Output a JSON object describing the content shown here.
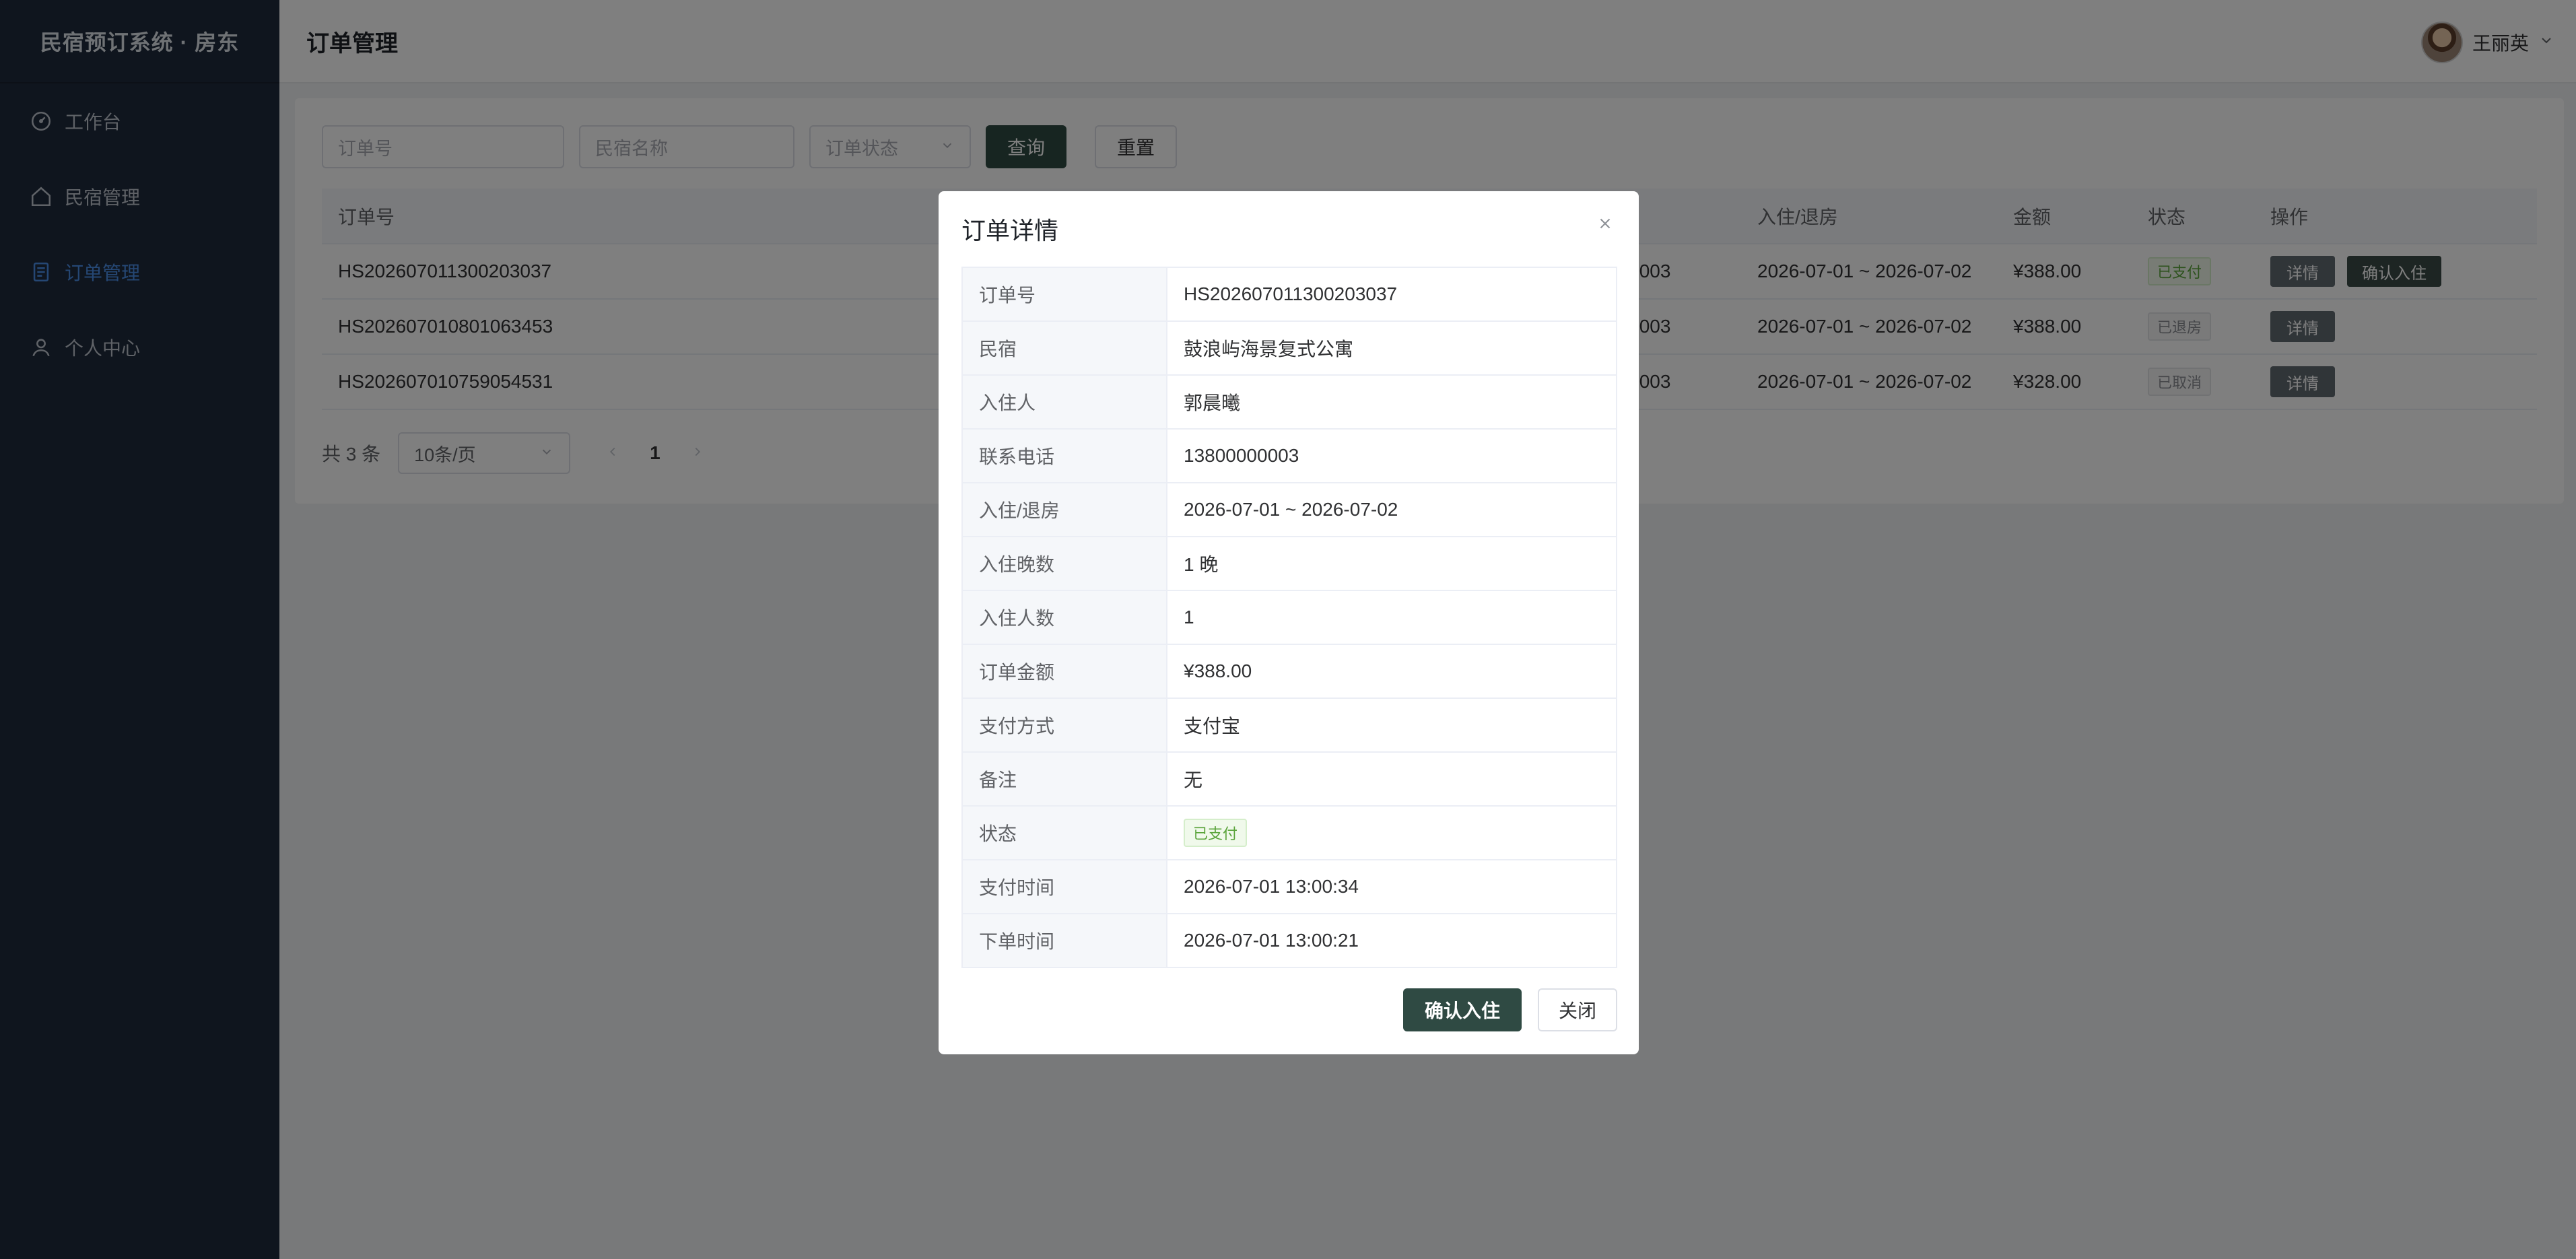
{
  "sidebar": {
    "brand": "民宿预订系统 · 房东",
    "items": [
      {
        "label": "工作台",
        "icon": "dashboard-icon"
      },
      {
        "label": "民宿管理",
        "icon": "home-icon"
      },
      {
        "label": "订单管理",
        "icon": "document-icon",
        "active": true
      },
      {
        "label": "个人中心",
        "icon": "user-icon"
      }
    ]
  },
  "header": {
    "title": "订单管理",
    "user_name": "王丽英"
  },
  "filters": {
    "order_no_placeholder": "订单号",
    "homestay_placeholder": "民宿名称",
    "status_placeholder": "订单状态",
    "query_label": "查询",
    "reset_label": "重置"
  },
  "table": {
    "columns": [
      "订单号",
      "入住/退房",
      "金额",
      "状态",
      "操作"
    ],
    "rows": [
      {
        "order_no": "HS202607011300203037",
        "phone_tail": "000003",
        "dates": "2026-07-01 ~ 2026-07-02",
        "amount": "¥388.00",
        "status": "已支付",
        "actions": [
          "详情",
          "确认入住"
        ]
      },
      {
        "order_no": "HS202607010801063453",
        "phone_tail": "000003",
        "dates": "2026-07-01 ~ 2026-07-02",
        "amount": "¥388.00",
        "status": "已退房",
        "actions": [
          "详情"
        ]
      },
      {
        "order_no": "HS202607010759054531",
        "phone_tail": "000003",
        "dates": "2026-07-01 ~ 2026-07-02",
        "amount": "¥328.00",
        "status": "已取消",
        "actions": [
          "详情"
        ]
      }
    ]
  },
  "pager": {
    "total": "共 3 条",
    "page_size": "10条/页",
    "current_page": "1"
  },
  "modal": {
    "title": "订单详情",
    "fields": [
      {
        "label": "订单号",
        "value": "HS202607011300203037"
      },
      {
        "label": "民宿",
        "value": "鼓浪屿海景复式公寓"
      },
      {
        "label": "入住人",
        "value": "郭晨曦"
      },
      {
        "label": "联系电话",
        "value": "13800000003"
      },
      {
        "label": "入住/退房",
        "value": "2026-07-01 ~ 2026-07-02"
      },
      {
        "label": "入住晚数",
        "value": "1 晚"
      },
      {
        "label": "入住人数",
        "value": "1"
      },
      {
        "label": "订单金额",
        "value": "¥388.00"
      },
      {
        "label": "支付方式",
        "value": "支付宝"
      },
      {
        "label": "备注",
        "value": "无"
      },
      {
        "label": "状态",
        "value": "已支付"
      },
      {
        "label": "支付时间",
        "value": "2026-07-01 13:00:34"
      },
      {
        "label": "下单时间",
        "value": "2026-07-01 13:00:21"
      }
    ],
    "confirm_label": "确认入住",
    "close_label": "关闭"
  },
  "colors": {
    "sidebar_bg": "#1f2a3c",
    "accent": "#4a8fe8",
    "primary_button": "#2f4a43",
    "paid_tag": "#5aa43b"
  }
}
